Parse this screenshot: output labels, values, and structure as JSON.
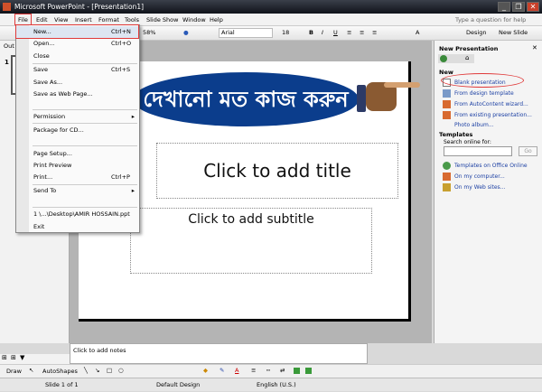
{
  "window": {
    "title": "Microsoft PowerPoint - [Presentation1]",
    "minimize": "_",
    "restore": "❐",
    "close": "✕"
  },
  "menubar": {
    "items": [
      "File",
      "Edit",
      "View",
      "Insert",
      "Format",
      "Tools",
      "Slide Show",
      "Window",
      "Help"
    ],
    "help_placeholder": "Type a question for help"
  },
  "toolbar": {
    "zoom": "58%",
    "font": "Arial",
    "size": "18",
    "bold": "B",
    "italic": "I",
    "underline": "U",
    "design": "Design",
    "new_slide": "New Slide"
  },
  "outline_tab": "Out",
  "slide_number": "1",
  "file_menu": [
    {
      "label": "New...",
      "shortcut": "Ctrl+N"
    },
    {
      "label": "Open...",
      "shortcut": "Ctrl+O"
    },
    {
      "label": "Close",
      "shortcut": ""
    },
    {
      "label": "Save",
      "shortcut": "Ctrl+S"
    },
    {
      "label": "Save As...",
      "shortcut": ""
    },
    {
      "label": "Save as Web Page...",
      "shortcut": ""
    },
    {
      "label": "Permission",
      "shortcut": "",
      "submenu": true
    },
    {
      "label": "Package for CD...",
      "shortcut": ""
    },
    {
      "label": "Page Setup...",
      "shortcut": ""
    },
    {
      "label": "Print Preview",
      "shortcut": ""
    },
    {
      "label": "Print...",
      "shortcut": "Ctrl+P"
    },
    {
      "label": "Send To",
      "shortcut": "",
      "submenu": true
    },
    {
      "label": "1 \\...\\Desktop\\AMIR HOSSAIN.ppt",
      "shortcut": ""
    },
    {
      "label": "Exit",
      "shortcut": ""
    }
  ],
  "slide": {
    "banner": "দেখানো মত কাজ করুন",
    "title_placeholder": "Click to add title",
    "subtitle_placeholder": "Click to add subtitle"
  },
  "taskpane": {
    "title": "New Presentation",
    "new_heading": "New",
    "new_items": [
      "Blank presentation",
      "From design template",
      "From AutoContent wizard...",
      "From existing presentation...",
      "Photo album..."
    ],
    "templates_heading": "Templates",
    "search_label": "Search online for:",
    "search_value": "",
    "go": "Go",
    "template_items": [
      "Templates on Office Online",
      "On my computer...",
      "On my Web sites..."
    ]
  },
  "notes_placeholder": "Click to add notes",
  "drawbar": {
    "draw": "Draw",
    "autoshapes": "AutoShapes"
  },
  "status": {
    "slide": "Slide 1 of 1",
    "design": "Default Design",
    "language": "English (U.S.)"
  },
  "colors": {
    "banner": "#0b3d8c",
    "highlight": "#e03a3a",
    "link": "#1b3fa3"
  }
}
